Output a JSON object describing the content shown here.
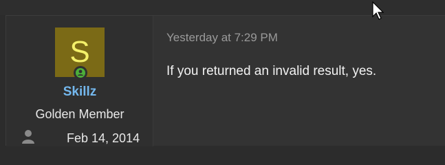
{
  "post": {
    "user": {
      "avatar_letter": "S",
      "username": "Skillz",
      "title": "Golden Member",
      "joined_date": "Feb 14, 2014",
      "avatar_color": "#7b6a16",
      "avatar_letter_color": "#f4f06a",
      "online_status_color": "#4caf3a"
    },
    "timestamp": "Yesterday at 7:29 PM",
    "message": "If you returned an invalid result, yes."
  },
  "icons": {
    "status": "online-icon",
    "joined": "user-icon",
    "pointer": "mouse-cursor"
  }
}
